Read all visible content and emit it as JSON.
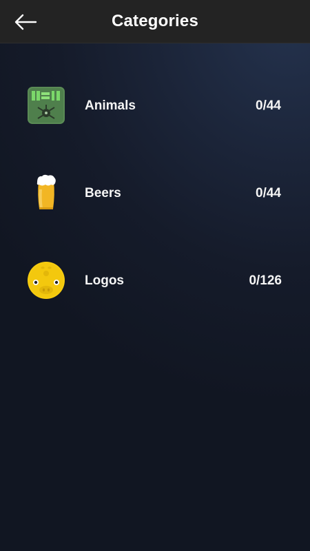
{
  "header": {
    "title": "Categories",
    "back_icon": "back-arrow-icon"
  },
  "categories": [
    {
      "label": "Animals",
      "progress": "0/44",
      "icon": "animals-category-icon"
    },
    {
      "label": "Beers",
      "progress": "0/44",
      "icon": "beer-glass-icon"
    },
    {
      "label": "Logos",
      "progress": "0/126",
      "icon": "pig-face-logo-icon"
    }
  ],
  "colors": {
    "topbar": "#232323",
    "background": "#151b2a",
    "text": "#ffffff"
  }
}
